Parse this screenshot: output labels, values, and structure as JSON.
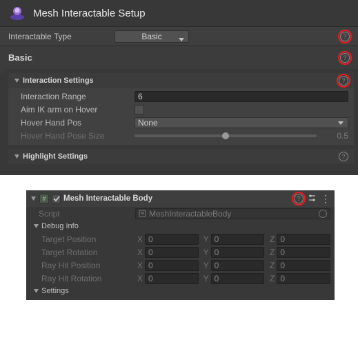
{
  "header": {
    "title": "Mesh Interactable Setup"
  },
  "typeRow": {
    "label": "Interactable Type",
    "value": "Basic"
  },
  "basic": {
    "title": "Basic",
    "interaction": {
      "title": "Interaction Settings",
      "rangeLabel": "Interaction Range",
      "rangeValue": "6",
      "aimLabel": "Aim IK arm on Hover",
      "hoverPosLabel": "Hover Hand Pos",
      "hoverPosVal": "None",
      "hoverSizeLabel": "Hover Hand Pose Size",
      "hoverSizeVal": "0.5"
    },
    "highlight": {
      "title": "Highlight Settings"
    }
  },
  "body": {
    "title": "Mesh Interactable Body",
    "scriptLabel": "Script",
    "scriptVal": "MeshInteractableBody",
    "debugTitle": "Debug Info",
    "vecs": [
      {
        "label": "Target Position",
        "x": "0",
        "y": "0",
        "z": "0"
      },
      {
        "label": "Target Rotation",
        "x": "0",
        "y": "0",
        "z": "0"
      },
      {
        "label": "Ray Hit Position",
        "x": "0",
        "y": "0",
        "z": "0"
      },
      {
        "label": "Ray Hit Rotation",
        "x": "0",
        "y": "0",
        "z": "0"
      }
    ],
    "settingsTitle": "Settings",
    "axes": {
      "x": "X",
      "y": "Y",
      "z": "Z"
    },
    "hashChar": "#"
  }
}
